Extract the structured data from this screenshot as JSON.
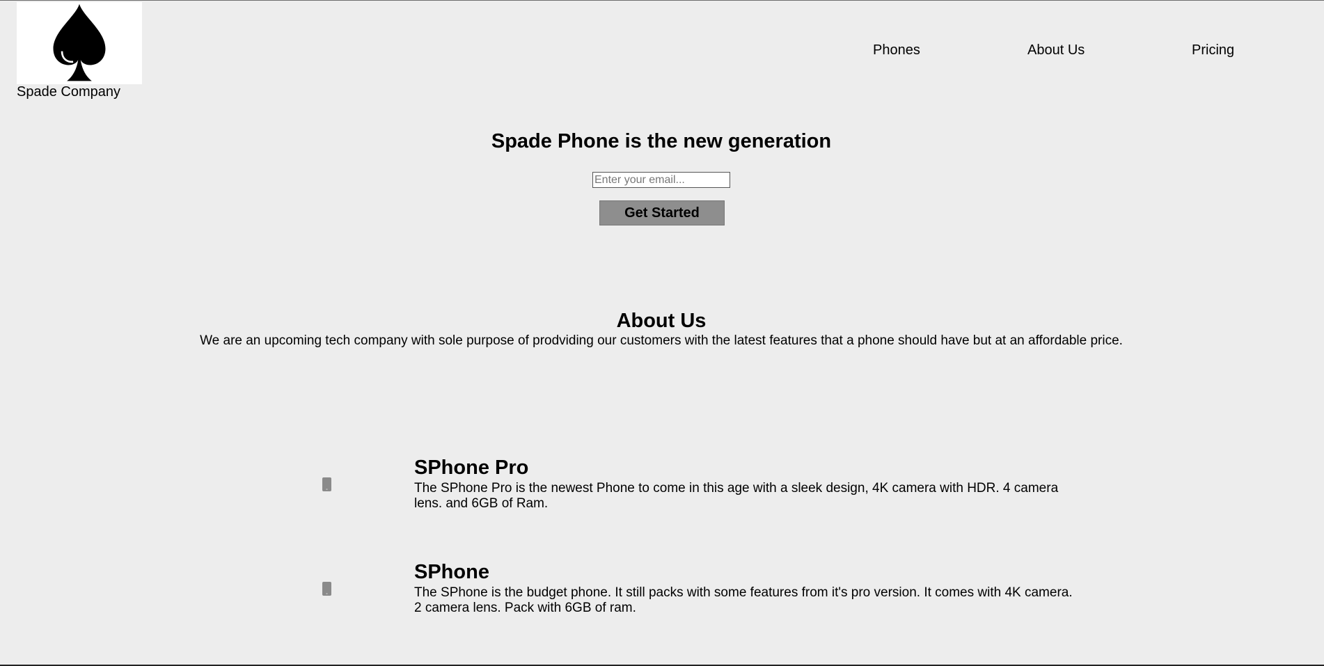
{
  "header": {
    "company_name": "Spade Company",
    "logo_icon": "spade-icon",
    "nav": [
      "Phones",
      "About Us",
      "Pricing"
    ]
  },
  "hero": {
    "title": "Spade Phone is the new generation",
    "email_placeholder": "Enter your email...",
    "email_value": "",
    "cta_label": "Get Started"
  },
  "about": {
    "title": "About Us",
    "text": "We are an upcoming tech company with sole purpose of prodviding our customers with the latest features that a phone should have but at an affordable price."
  },
  "products": [
    {
      "name": "SPhone Pro",
      "icon": "phone-icon",
      "description": "The SPhone Pro is the newest Phone to come in this age with a sleek design, 4K camera with HDR. 4 camera lens. and 6GB of Ram."
    },
    {
      "name": "SPhone",
      "icon": "phone-icon",
      "description": "The SPhone is the budget phone. It still packs with some features from it's pro version. It comes with 4K camera. 2 camera lens. Pack with 6GB of ram."
    }
  ],
  "colors": {
    "background": "#ededed",
    "button": "#8e8e8e",
    "icon": "#8a8a8a"
  }
}
